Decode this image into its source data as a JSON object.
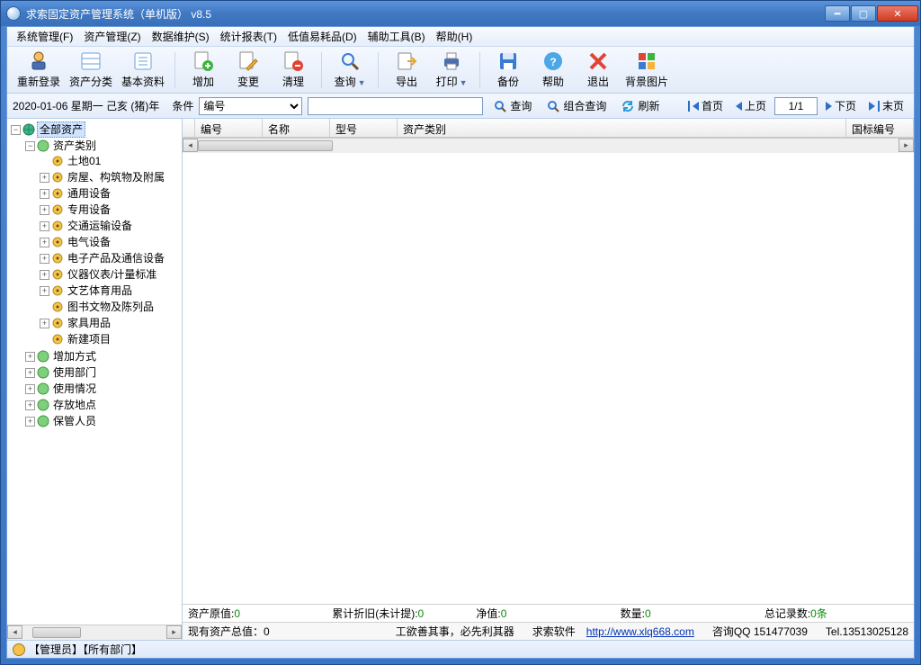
{
  "window": {
    "title": "求索固定资产管理系统（单机版） v8.5"
  },
  "menu": [
    "系统管理(F)",
    "资产管理(Z)",
    "数据维护(S)",
    "统计报表(T)",
    "低值易耗品(D)",
    "辅助工具(B)",
    "帮助(H)"
  ],
  "toolbar": {
    "relogin": "重新登录",
    "category": "资产分类",
    "baseinfo": "基本资料",
    "add": "增加",
    "change": "变更",
    "clean": "清理",
    "query": "查询",
    "export": "导出",
    "print": "打印",
    "backup": "备份",
    "help": "帮助",
    "exit": "退出",
    "bgimg": "背景图片"
  },
  "cond": {
    "date": "2020-01-06 星期一 己亥 (猪)年",
    "label": "条件",
    "field": "编号",
    "value": "",
    "search": "查询",
    "combo": "组合查询",
    "refresh": "刷新",
    "first": "首页",
    "prev": "上页",
    "page": "1/1",
    "next": "下页",
    "last": "末页"
  },
  "tree": {
    "root": "全部资产",
    "cat": "资产类别",
    "items": [
      "土地01",
      "房屋、构筑物及附属",
      "通用设备",
      "专用设备",
      "交通运输设备",
      "电气设备",
      "电子产品及通信设备",
      "仪器仪表/计量标准",
      "文艺体育用品",
      "图书文物及陈列品",
      "家具用品",
      "新建项目"
    ],
    "exp": [
      "none",
      "plus",
      "plus",
      "plus",
      "plus",
      "plus",
      "plus",
      "plus",
      "plus",
      "none",
      "plus",
      "none"
    ],
    "others": [
      "增加方式",
      "使用部门",
      "使用情况",
      "存放地点",
      "保管人员"
    ]
  },
  "grid": {
    "cols": [
      "编号",
      "名称",
      "型号",
      "资产类别",
      "国标编号"
    ]
  },
  "summary": {
    "c1l": "资产原值:",
    "c1v": "0",
    "c2l": "累计折旧(未计提):",
    "c2v": "0",
    "c3l": "净值:",
    "c3v": "0",
    "c4l": "数量:",
    "c4v": "0",
    "c5l": "总记录数:",
    "c5v": "0条"
  },
  "footer": {
    "left": "现有资产总值：0",
    "mid": "工欲善其事，必先利其器",
    "brand": "求索软件",
    "url": "http://www.xlq668.com",
    "qq": "咨询QQ 151477039",
    "tel": "Tel.13513025128"
  },
  "status": {
    "user": "【管理员】【所有部门】"
  }
}
